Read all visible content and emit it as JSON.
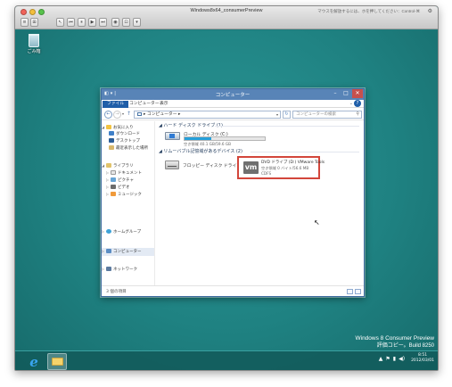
{
  "host": {
    "title": "Windows8x64_consumerPreview",
    "status": "マウスを解放するには、ホを押してください：Control-⌘",
    "toolbar_buttons": [
      "≡",
      "⊞",
      "↖",
      "⏮",
      "⏸",
      "▶",
      "⏭",
      "◉",
      "⊡",
      "▾"
    ]
  },
  "desktop": {
    "recycle_bin_label": "ごみ箱",
    "watermark_line1": "Windows 8 Consumer Preview",
    "watermark_line2": "評価コピー。Build 8250"
  },
  "taskbar": {
    "ie_glyph": "e",
    "tray_glyphs": [
      "▲",
      "⚑",
      "▮",
      "◀)"
    ],
    "time": "8:51",
    "date": "2012/03/01"
  },
  "explorer": {
    "title": "コンピューター",
    "qa_glyphs": [
      "◧",
      "▾",
      "|"
    ],
    "window_controls": {
      "minimize": "–",
      "maximize": "□",
      "close": "✕"
    },
    "ribbon_tabs": {
      "file": "ファイル",
      "computer": "コンピューター",
      "view": "表示"
    },
    "ribbon_caret": "⌄",
    "help_glyph": "?",
    "nav_buttons": {
      "back": "←",
      "forward": "→",
      "recent": "▾",
      "up": "↑"
    },
    "address": "▸ コンピューター ▸",
    "address_dropdown": "▾",
    "refresh_glyph": "↻",
    "search_placeholder": "コンピューターの検索",
    "search_glyph": "⚲",
    "nav_pane": {
      "favorites": "お気に入り",
      "downloads": "ダウンロード",
      "desktop": "デスクトップ",
      "recent": "最近表示した場所",
      "libraries": "ライブラリ",
      "documents": "ドキュメント",
      "pictures": "ピクチャ",
      "videos": "ビデオ",
      "music": "ミュージック",
      "homegroup": "ホームグループ",
      "computer": "コンピューター",
      "network": "ネットワーク",
      "expand_open": "◢",
      "expand_closed": "▷"
    },
    "sections": {
      "hdd_header": "◢ ハード ディスク ドライブ (1)",
      "removable_header": "◢ リムーバブル記憶域があるデバイス (2)"
    },
    "drives": {
      "local_disk": {
        "name": "ローカル ディスク (C:)",
        "free": "空き領域 40.1 GB/59.6 GB",
        "used_fraction": 0.33
      },
      "floppy": {
        "name": "フロッピー ディスク ドライブ (A:)"
      },
      "dvd": {
        "name": "DVD ドライブ (D:) VMware Tools",
        "free": "空き領域 0 バイト/56.6 MB",
        "filesystem": "CDFS",
        "logo_text": "vm"
      }
    },
    "cursor_glyph": "↖",
    "status_count": "3 個の項目"
  },
  "colors": {
    "desktop_teal": "#1f8282",
    "explorer_title": "#5884b7",
    "file_tab": "#1f5ea8",
    "selection_highlight": "#d3463b",
    "disk_fill": "#26a0da"
  }
}
